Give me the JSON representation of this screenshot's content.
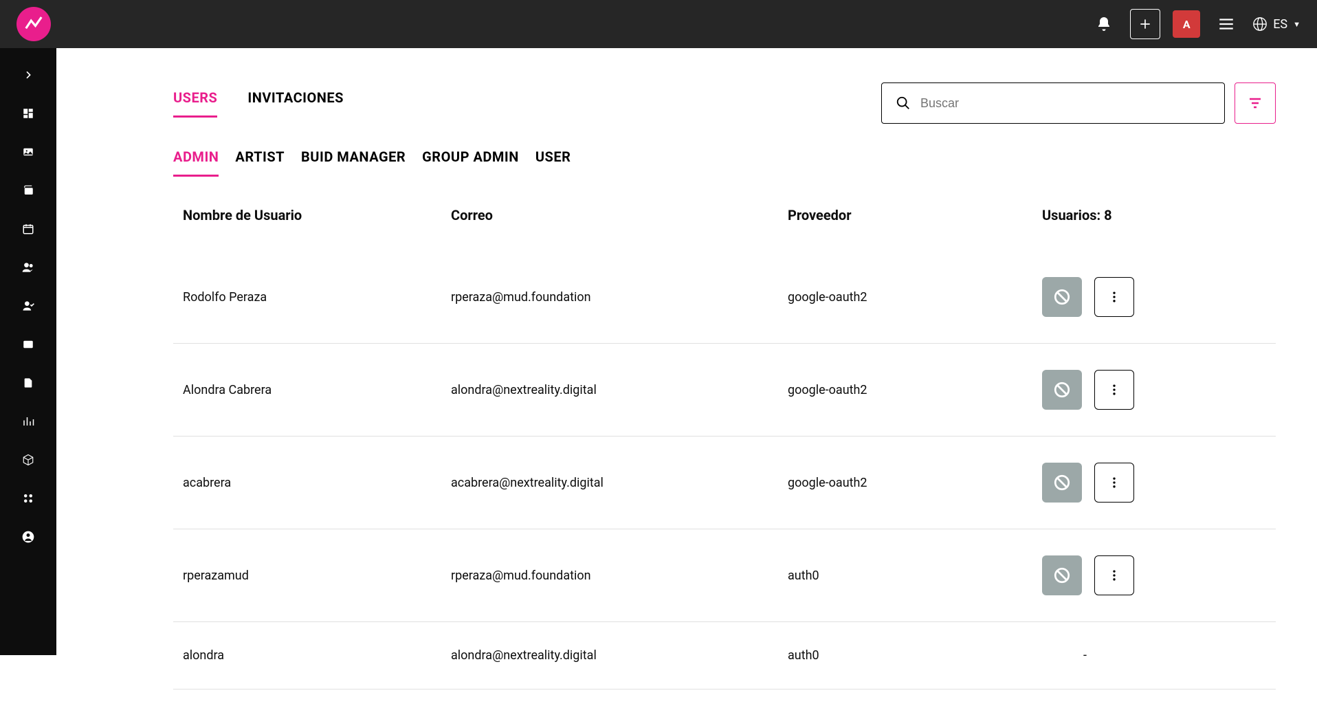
{
  "topbar": {
    "avatar_letter": "A",
    "language": "ES"
  },
  "tabs": {
    "users": "USERS",
    "invitations": "INVITACIONES"
  },
  "search": {
    "placeholder": "Buscar"
  },
  "role_tabs": {
    "admin": "ADMIN",
    "artist": "ARTIST",
    "buid_manager": "BUID MANAGER",
    "group_admin": "GROUP ADMIN",
    "user": "USER"
  },
  "table": {
    "headers": {
      "username": "Nombre de Usuario",
      "email": "Correo",
      "provider": "Proveedor",
      "count_label": "Usuarios: 8"
    },
    "rows": [
      {
        "username": "Rodolfo Peraza",
        "email": "rperaza@mud.foundation",
        "provider": "google-oauth2",
        "has_actions": true
      },
      {
        "username": "Alondra Cabrera",
        "email": "alondra@nextreality.digital",
        "provider": "google-oauth2",
        "has_actions": true
      },
      {
        "username": "acabrera",
        "email": "acabrera@nextreality.digital",
        "provider": "google-oauth2",
        "has_actions": true
      },
      {
        "username": "rperazamud",
        "email": "rperaza@mud.foundation",
        "provider": "auth0",
        "has_actions": true
      },
      {
        "username": "alondra",
        "email": "alondra@nextreality.digital",
        "provider": "auth0",
        "has_actions": false,
        "dash": "-"
      }
    ]
  }
}
